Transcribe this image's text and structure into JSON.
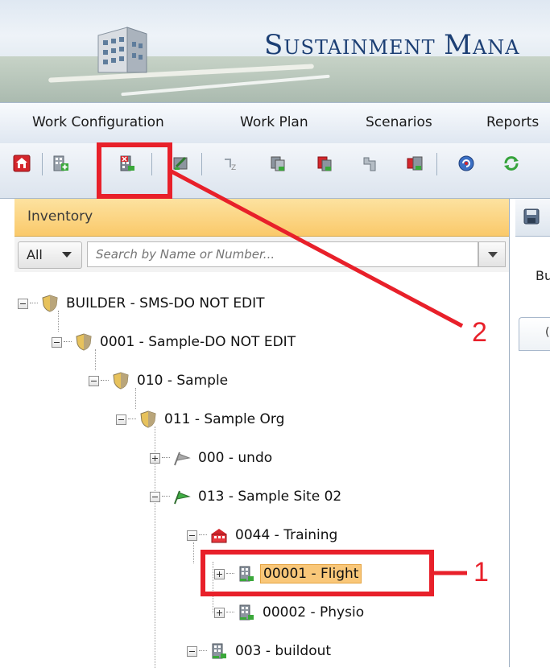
{
  "banner": {
    "title_first_cap": "S",
    "title_first_rest": "ustainment",
    "title_second_cap": "M",
    "title_second_rest": "ana",
    "logo_icon": "building-icon"
  },
  "menu": {
    "items": [
      {
        "label": "Work Configuration"
      },
      {
        "label": "Work Plan"
      },
      {
        "label": "Scenarios"
      },
      {
        "label": "Reports"
      }
    ]
  },
  "toolbar": {
    "buttons": [
      {
        "icon": "home-icon"
      },
      {
        "icon": "add-building-icon"
      },
      {
        "icon": "delete-building-icon"
      },
      {
        "icon": "edit-building-icon"
      },
      {
        "icon": "sort-icon"
      },
      {
        "icon": "copy-icon"
      },
      {
        "icon": "cut-icon"
      },
      {
        "icon": "move-icon"
      },
      {
        "icon": "import-icon"
      },
      {
        "icon": "refresh-icon"
      },
      {
        "icon": "sync-icon"
      }
    ]
  },
  "inventory": {
    "title": "Inventory",
    "filter_value": "All",
    "search_placeholder": "Search by Name or Number..."
  },
  "tree": {
    "nodes": [
      {
        "label": "BUILDER - SMS-DO NOT EDIT",
        "icon": "shield-icon",
        "expanded": true
      },
      {
        "label": "0001 - Sample-DO NOT EDIT",
        "icon": "shield-icon",
        "expanded": true
      },
      {
        "label": "010 - Sample",
        "icon": "shield-icon",
        "expanded": true
      },
      {
        "label": "011 - Sample Org",
        "icon": "shield-icon",
        "expanded": true
      },
      {
        "label": "000 - undo",
        "icon": "grey-flag-icon",
        "expanded": false
      },
      {
        "label": "013 - Sample Site 02",
        "icon": "green-flag-icon",
        "expanded": true
      },
      {
        "label": "0044 - Training",
        "icon": "complex-icon",
        "expanded": true
      },
      {
        "label": "00001 - Flight",
        "icon": "building-icon",
        "expanded": false,
        "selected": true
      },
      {
        "label": "00002 - Physio",
        "icon": "building-icon",
        "expanded": false
      },
      {
        "label": "003 - buildout",
        "icon": "building-icon",
        "expanded": true
      }
    ]
  },
  "right_panel": {
    "text_fragment": "Bu",
    "tab_fragment": "("
  },
  "annotations": {
    "callout_1": "1",
    "callout_2": "2",
    "color": "#e8202a"
  }
}
